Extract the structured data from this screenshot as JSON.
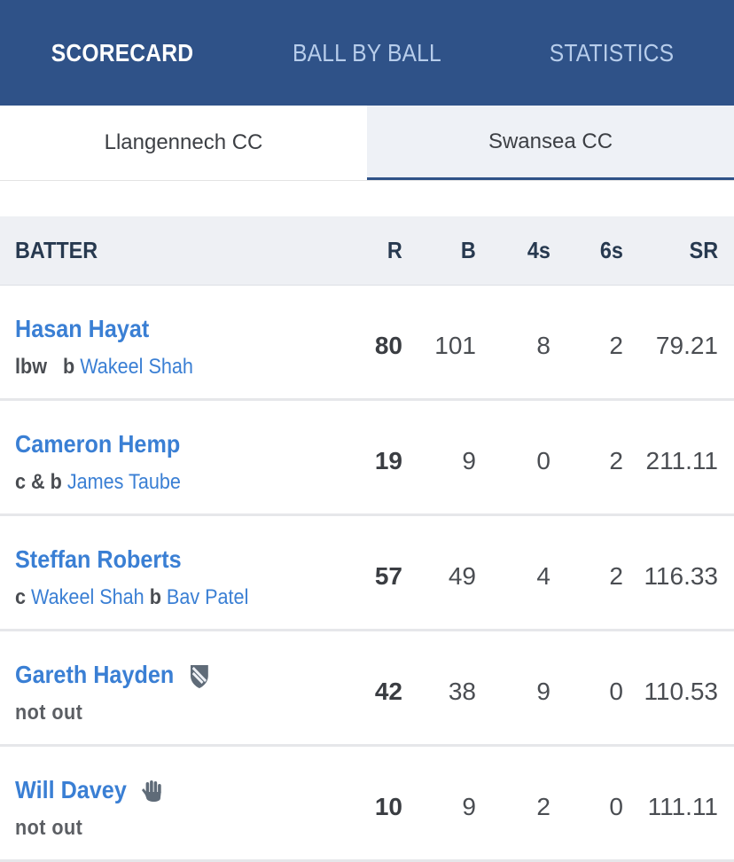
{
  "nav": {
    "tabs": [
      {
        "label": "SCORECARD",
        "active": true
      },
      {
        "label": "BALL BY BALL",
        "active": false
      },
      {
        "label": "STATISTICS",
        "active": false
      }
    ]
  },
  "teams": [
    {
      "label": "Llangennech CC",
      "active": false
    },
    {
      "label": "Swansea CC",
      "active": true
    }
  ],
  "table": {
    "headers": {
      "batter": "BATTER",
      "r": "R",
      "b": "B",
      "fours": "4s",
      "sixes": "6s",
      "sr": "SR"
    },
    "rows": [
      {
        "name": "Hasan Hayat",
        "icon": null,
        "dismissal": {
          "type1": "lbw",
          "kw": "b",
          "bowler": "Wakeel Shah"
        },
        "r": "80",
        "b": "101",
        "fours": "8",
        "sixes": "2",
        "sr": "79.21"
      },
      {
        "name": "Cameron Hemp",
        "icon": null,
        "dismissal": {
          "type1": "c & b",
          "bowler": "James Taube"
        },
        "r": "19",
        "b": "9",
        "fours": "0",
        "sixes": "2",
        "sr": "211.11"
      },
      {
        "name": "Steffan Roberts",
        "icon": null,
        "dismissal": {
          "type1": "c",
          "fielder": "Wakeel Shah",
          "kw": "b",
          "bowler": "Bav Patel"
        },
        "r": "57",
        "b": "49",
        "fours": "4",
        "sixes": "2",
        "sr": "116.33"
      },
      {
        "name": "Gareth Hayden",
        "icon": "captain-shield-icon",
        "dismissal": {
          "status": "not out"
        },
        "r": "42",
        "b": "38",
        "fours": "9",
        "sixes": "0",
        "sr": "110.53"
      },
      {
        "name": "Will Davey",
        "icon": "wicketkeeper-glove-icon",
        "dismissal": {
          "status": "not out"
        },
        "r": "10",
        "b": "9",
        "fours": "2",
        "sixes": "0",
        "sr": "111.11"
      }
    ]
  },
  "colors": {
    "header_bg": "#2f5288",
    "link": "#3a7fd4",
    "table_header_bg": "#eef0f4"
  }
}
